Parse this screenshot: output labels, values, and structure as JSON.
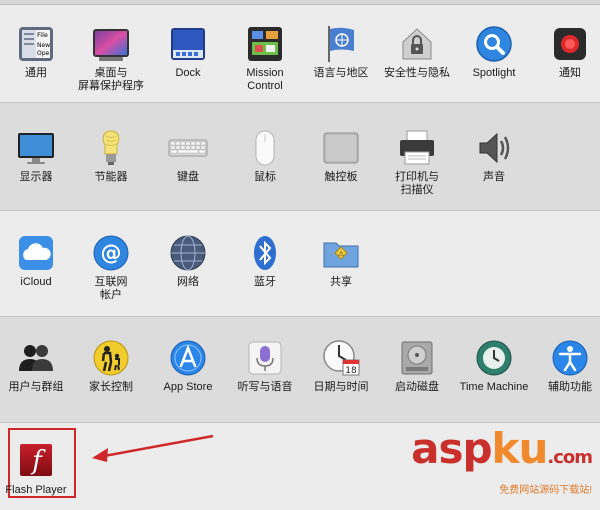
{
  "rows": [
    {
      "items": [
        {
          "icon": "general-icon",
          "label": "通用"
        },
        {
          "icon": "desktop-screensaver-icon",
          "label": "桌面与\n屏幕保护程序"
        },
        {
          "icon": "dock-icon",
          "label": "Dock"
        },
        {
          "icon": "mission-control-icon",
          "label": "Mission\nControl"
        },
        {
          "icon": "language-region-icon",
          "label": "语言与地区"
        },
        {
          "icon": "security-privacy-icon",
          "label": "安全性与隐私"
        },
        {
          "icon": "spotlight-icon",
          "label": "Spotlight"
        },
        {
          "icon": "notifications-icon",
          "label": "通知"
        }
      ]
    },
    {
      "items": [
        {
          "icon": "displays-icon",
          "label": "显示器"
        },
        {
          "icon": "energy-saver-icon",
          "label": "节能器"
        },
        {
          "icon": "keyboard-icon",
          "label": "键盘"
        },
        {
          "icon": "mouse-icon",
          "label": "鼠标"
        },
        {
          "icon": "trackpad-icon",
          "label": "触控板"
        },
        {
          "icon": "printers-scanners-icon",
          "label": "打印机与\n扫描仪"
        },
        {
          "icon": "sound-icon",
          "label": "声音"
        }
      ]
    },
    {
      "items": [
        {
          "icon": "icloud-icon",
          "label": "iCloud"
        },
        {
          "icon": "internet-accounts-icon",
          "label": "互联网\n帐户"
        },
        {
          "icon": "network-icon",
          "label": "网络"
        },
        {
          "icon": "bluetooth-icon",
          "label": "蓝牙"
        },
        {
          "icon": "sharing-icon",
          "label": "共享"
        }
      ]
    },
    {
      "items": [
        {
          "icon": "users-groups-icon",
          "label": "用户与群组"
        },
        {
          "icon": "parental-controls-icon",
          "label": "家长控制"
        },
        {
          "icon": "app-store-icon",
          "label": "App Store"
        },
        {
          "icon": "dictation-speech-icon",
          "label": "听写与语音"
        },
        {
          "icon": "date-time-icon",
          "label": "日期与时间"
        },
        {
          "icon": "startup-disk-icon",
          "label": "启动磁盘"
        },
        {
          "icon": "time-machine-icon",
          "label": "Time Machine"
        },
        {
          "icon": "accessibility-icon",
          "label": "辅助功能"
        }
      ]
    },
    {
      "items": [
        {
          "icon": "flash-player-icon",
          "label": "Flash Player"
        }
      ]
    }
  ],
  "icon_text": {
    "general_file": "File",
    "general_new": "New",
    "general_ope": "Ope",
    "calendar_day": "18",
    "icloud_note": "",
    "flash_letter": "f"
  },
  "watermark": {
    "text_a": "asp",
    "text_b": "ku",
    "text_c": ".com",
    "sub": "免费网站源码下载站!"
  },
  "colors": {
    "highlight_red": "#d0282a",
    "watermark_red": "#c9302c",
    "watermark_orange": "#f08a2c"
  }
}
